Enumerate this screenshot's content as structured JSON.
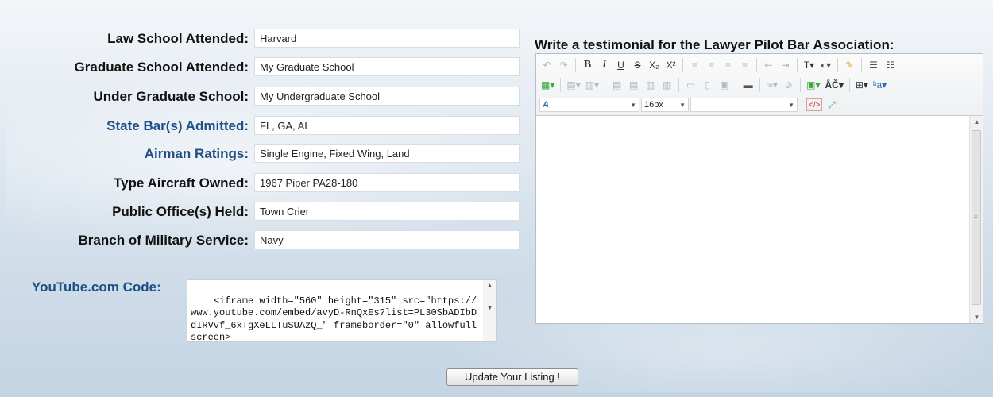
{
  "form": {
    "fields": [
      {
        "label": "Law School Attended:",
        "value": "Harvard"
      },
      {
        "label": "Graduate School Attended:",
        "value": "My Graduate School"
      },
      {
        "label": "Under Graduate School:",
        "value": "My Undergraduate School"
      },
      {
        "label": "State Bar(s) Admitted:",
        "value": "FL, GA, AL"
      },
      {
        "label": "Airman Ratings:",
        "value": "Single Engine, Fixed Wing, Land"
      },
      {
        "label": "Type Aircraft Owned:",
        "value": "1967 Piper PA28-180"
      },
      {
        "label": "Public Office(s) Held:",
        "value": "Town Crier"
      },
      {
        "label": "Branch of Military Service:",
        "value": "Navy"
      }
    ],
    "youtube": {
      "label": "YouTube.com Code:",
      "value": "<iframe width=\"560\" height=\"315\" src=\"https://www.youtube.com/embed/avyD-RnQxEs?list=PL30SbADIbDdIRVvf_6xTgXeLLTuSUAzQ_\" frameborder=\"0\" allowfullscreen>"
    }
  },
  "testimonial": {
    "title": "Write a testimonial for the Lawyer Pilot Bar Association:",
    "font_size_value": "16px",
    "font_name_value": "",
    "block_value": "",
    "content": ""
  },
  "colors": {
    "label_blue": "#1f4f86",
    "label_dark": "#111111"
  },
  "submit": {
    "label": "Update Your Listing !"
  }
}
